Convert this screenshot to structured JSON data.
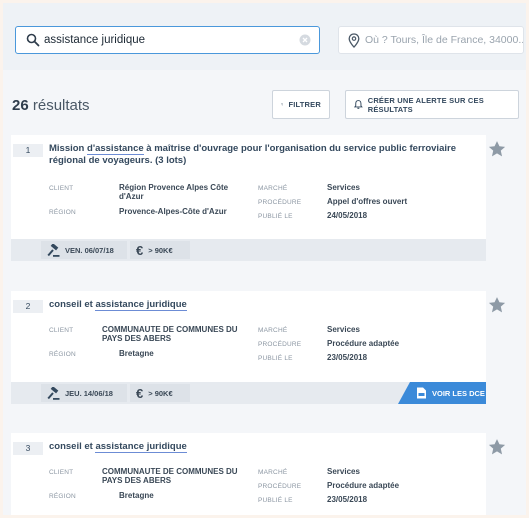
{
  "search": {
    "what_value": "assistance juridique",
    "where_placeholder": "Où ? Tours, Île de France, 34000..."
  },
  "results": {
    "count": "26",
    "count_label": "résultats",
    "filter_label": "Filtrer",
    "alert_label": "Créer une alerte sur ces résultats"
  },
  "labels": {
    "client": "CLIENT",
    "region": "RÉGION",
    "marche": "MARCHÉ",
    "procedure": "PROCÉDURE",
    "publie": "PUBLIÉ LE",
    "voir_dce": "VOIR LES DCE"
  },
  "cards": [
    {
      "number": "1",
      "title_pre": "Mission ",
      "title_kw": "d'assistance",
      "title_post": " à maîtrise d'ouvrage pour l'organisation du service public ferroviaire régional de voyageurs. (3 lots)",
      "client": "Région Provence Alpes Côte d'Azur",
      "region": "Provence-Alpes-Côte d'Azur",
      "marche": "Services",
      "procedure": "Appel d'offres ouvert",
      "publie": "24/05/2018",
      "deadline": "VEN. 06/07/18",
      "amount": "> 90K€"
    },
    {
      "number": "2",
      "title_pre": "conseil et ",
      "title_kw": "assistance juridique",
      "title_post": "",
      "client": "COMMUNAUTE DE COMMUNES DU PAYS DES ABERS",
      "region": "Bretagne",
      "marche": "Services",
      "procedure": "Procédure adaptée",
      "publie": "23/05/2018",
      "deadline": "JEU. 14/06/18",
      "amount": "> 90K€"
    },
    {
      "number": "3",
      "title_pre": "conseil et ",
      "title_kw": "assistance juridique",
      "title_post": "",
      "client": "COMMUNAUTE DE COMMUNES DU PAYS DES ABERS",
      "region": "Bretagne",
      "marche": "Services",
      "procedure": "Procédure adaptée",
      "publie": "23/05/2018"
    }
  ]
}
